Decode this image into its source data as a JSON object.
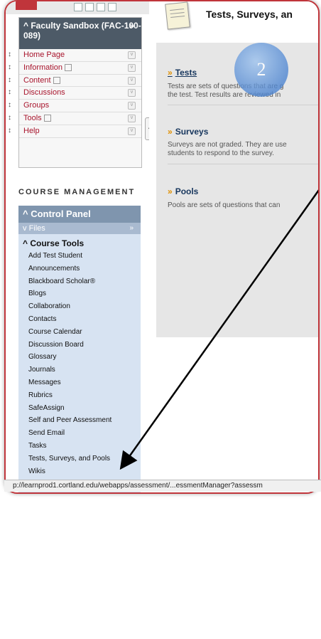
{
  "course": {
    "title": "Faculty Sandbox (FAC-100-089)",
    "menu": [
      {
        "label": "Home Page"
      },
      {
        "label": "Information"
      },
      {
        "label": "Content"
      },
      {
        "label": "Discussions"
      },
      {
        "label": "Groups"
      },
      {
        "label": "Tools"
      },
      {
        "label": "Help"
      }
    ]
  },
  "course_management": {
    "title": "COURSE MANAGEMENT",
    "control_panel": "Control Panel",
    "files": "Files",
    "course_tools_heading": "Course Tools",
    "tools": [
      "Add Test Student",
      "Announcements",
      "Blackboard Scholar®",
      "Blogs",
      "Collaboration",
      "Contacts",
      "Course Calendar",
      "Discussion Board",
      "Glossary",
      "Journals",
      "Messages",
      "Rubrics",
      "SafeAssign",
      "Self and Peer Assessment",
      "Send Email",
      "Tasks",
      "Tests, Surveys, and Pools",
      "Wikis"
    ]
  },
  "main": {
    "page_title": "Tests, Surveys, an",
    "sections": [
      {
        "title": "Tests",
        "desc_line1": "Tests are sets of questions that are g",
        "desc_line2": "the test. Test results are reviewed in"
      },
      {
        "title": "Surveys",
        "desc_line1": "Surveys are not graded. They are use",
        "desc_line2": "students to respond to the survey."
      },
      {
        "title": "Pools",
        "desc_line1": "Pools are sets of questions that can",
        "desc_line2": ""
      }
    ]
  },
  "annotation": {
    "step_number": "2"
  },
  "status_url": "p://learnprod1.cortland.edu/webapps/assessment/...essmentManager?assessm",
  "colors": {
    "accent": "#c0353b",
    "panel_head": "#4d5a67",
    "control_panel": "#7f95ae",
    "control_bg": "#d7e3f2"
  }
}
